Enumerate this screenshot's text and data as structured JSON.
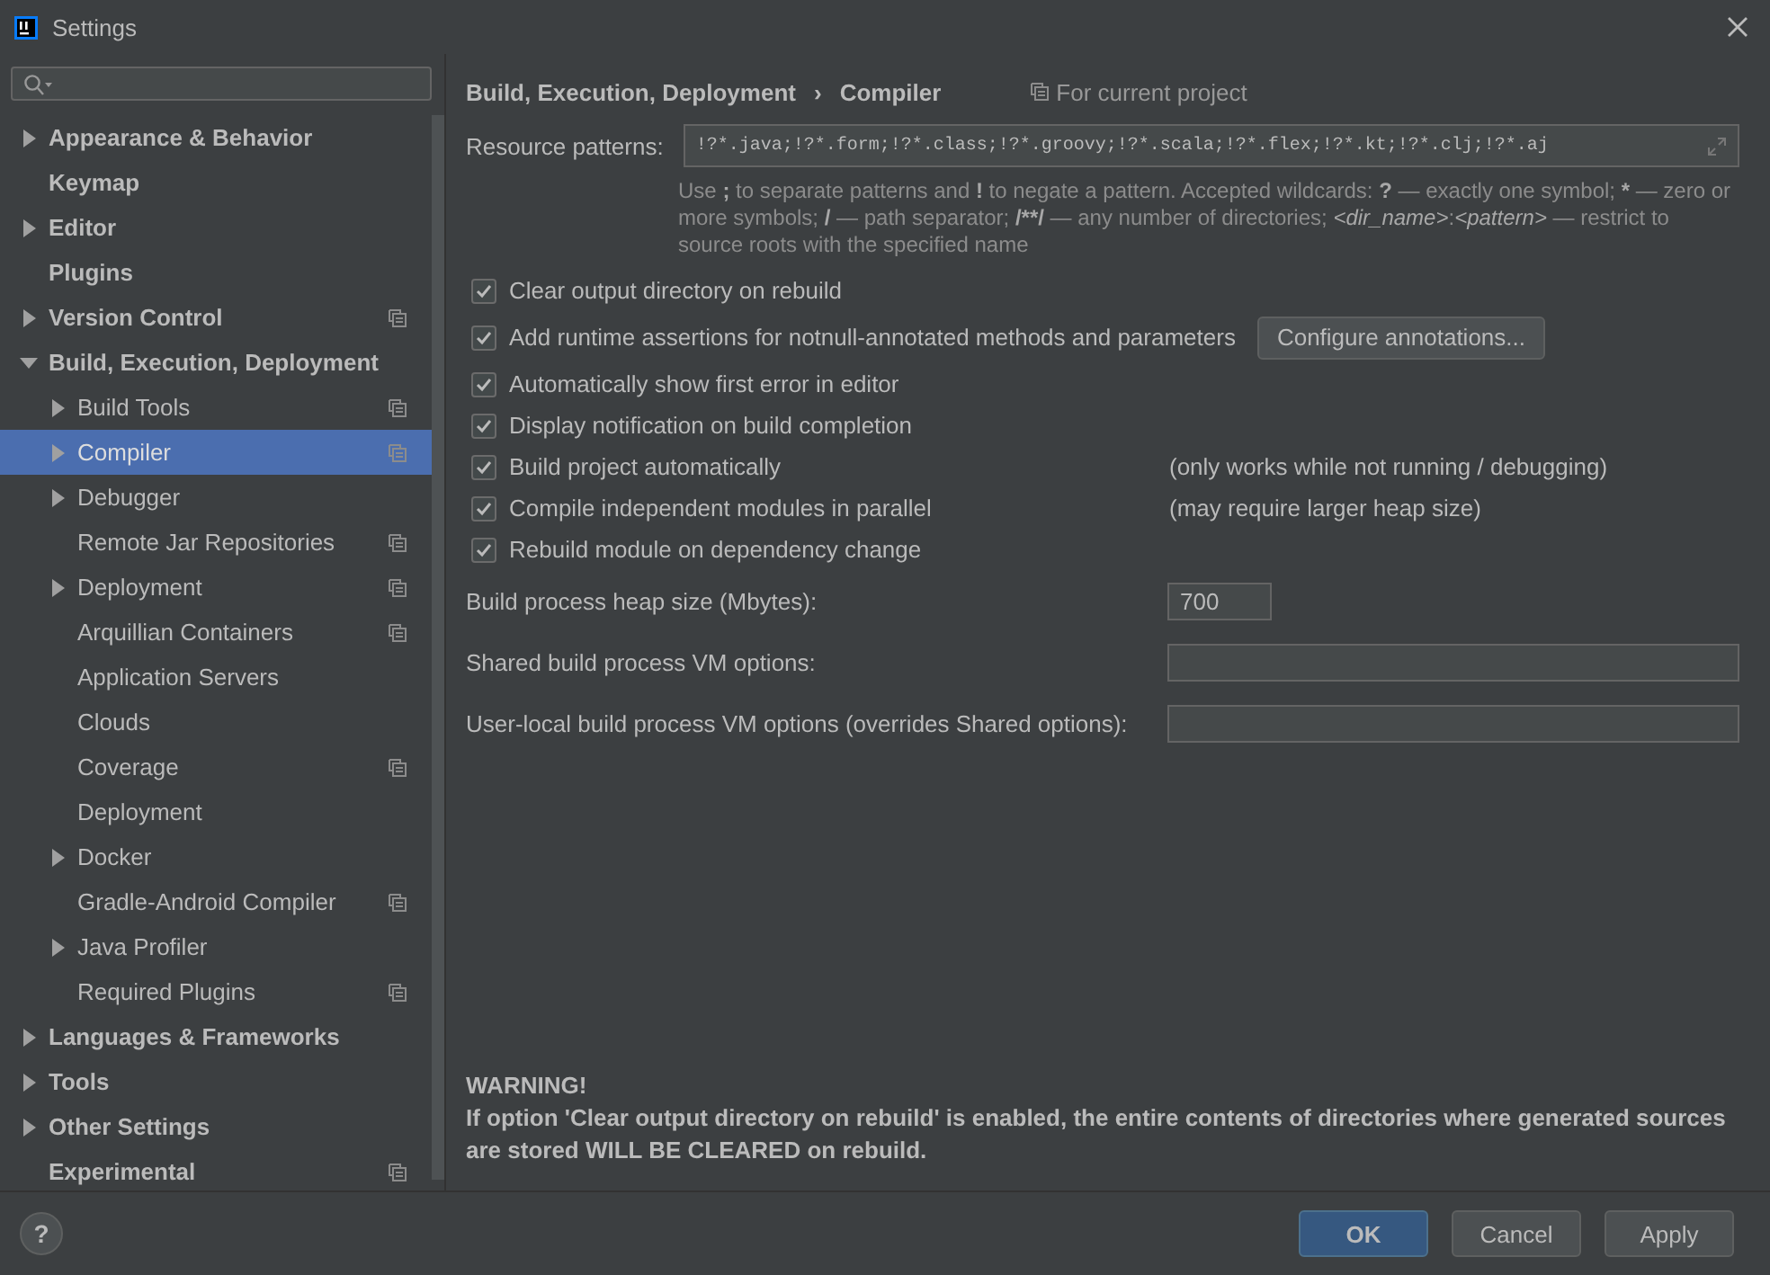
{
  "window": {
    "title": "Settings"
  },
  "tree": [
    {
      "label": "Appearance & Behavior",
      "kind": "group",
      "expanded": false,
      "selected": false,
      "project": false
    },
    {
      "label": "Keymap",
      "kind": "leaf",
      "selected": false,
      "project": false
    },
    {
      "label": "Editor",
      "kind": "group",
      "expanded": false,
      "selected": false,
      "project": false
    },
    {
      "label": "Plugins",
      "kind": "leaf",
      "selected": false,
      "project": false
    },
    {
      "label": "Version Control",
      "kind": "group",
      "expanded": false,
      "selected": false,
      "project": true
    },
    {
      "label": "Build, Execution, Deployment",
      "kind": "group",
      "expanded": true,
      "selected": false,
      "project": false,
      "children": [
        {
          "label": "Build Tools",
          "kind": "group",
          "expanded": false,
          "selected": false,
          "project": true
        },
        {
          "label": "Compiler",
          "kind": "group",
          "expanded": false,
          "selected": true,
          "project": true
        },
        {
          "label": "Debugger",
          "kind": "group",
          "expanded": false,
          "selected": false,
          "project": false
        },
        {
          "label": "Remote Jar Repositories",
          "kind": "leaf",
          "selected": false,
          "project": true
        },
        {
          "label": "Deployment",
          "kind": "group",
          "expanded": false,
          "selected": false,
          "project": true
        },
        {
          "label": "Arquillian Containers",
          "kind": "leaf",
          "selected": false,
          "project": true
        },
        {
          "label": "Application Servers",
          "kind": "leaf",
          "selected": false,
          "project": false
        },
        {
          "label": "Clouds",
          "kind": "leaf",
          "selected": false,
          "project": false
        },
        {
          "label": "Coverage",
          "kind": "leaf",
          "selected": false,
          "project": true
        },
        {
          "label": "Deployment",
          "kind": "leaf",
          "selected": false,
          "project": false
        },
        {
          "label": "Docker",
          "kind": "group",
          "expanded": false,
          "selected": false,
          "project": false
        },
        {
          "label": "Gradle-Android Compiler",
          "kind": "leaf",
          "selected": false,
          "project": true
        },
        {
          "label": "Java Profiler",
          "kind": "group",
          "expanded": false,
          "selected": false,
          "project": false
        },
        {
          "label": "Required Plugins",
          "kind": "leaf",
          "selected": false,
          "project": true
        }
      ]
    },
    {
      "label": "Languages & Frameworks",
      "kind": "group",
      "expanded": false,
      "selected": false,
      "project": false
    },
    {
      "label": "Tools",
      "kind": "group",
      "expanded": false,
      "selected": false,
      "project": false
    },
    {
      "label": "Other Settings",
      "kind": "group",
      "expanded": false,
      "selected": false,
      "project": false
    },
    {
      "label": "Experimental",
      "kind": "leaf",
      "selected": false,
      "project": true
    }
  ],
  "breadcrumb": [
    "Build, Execution, Deployment",
    "›",
    "Compiler"
  ],
  "scope": "For current project",
  "resource_patterns": {
    "label": "Resource patterns:",
    "value": "!?*.java;!?*.form;!?*.class;!?*.groovy;!?*.scala;!?*.flex;!?*.kt;!?*.clj;!?*.aj"
  },
  "help_text": [
    {
      "text": "Use ",
      "kind": "prose"
    },
    {
      "text": ";",
      "kind": "symbol"
    },
    {
      "text": " to separate patterns and ",
      "kind": "prose"
    },
    {
      "text": "!",
      "kind": "symbol"
    },
    {
      "text": " to negate a pattern. Accepted wildcards: ",
      "kind": "prose"
    },
    {
      "text": "?",
      "kind": "symbol"
    },
    {
      "text": " — exactly one symbol; ",
      "kind": "prose"
    },
    {
      "text": "*",
      "kind": "symbol"
    },
    {
      "text": " — zero or more symbols; ",
      "kind": "prose"
    },
    {
      "text": "/",
      "kind": "symbol"
    },
    {
      "text": " — path separator; ",
      "kind": "prose"
    },
    {
      "text": "/**/",
      "kind": "symbol"
    },
    {
      "text": " — any number of directories;  ",
      "kind": "prose"
    },
    {
      "text": "<dir_name>",
      "kind": "placeholder"
    },
    {
      "text": ":",
      "kind": "prose"
    },
    {
      "text": "<pattern>",
      "kind": "placeholder"
    },
    {
      "text": " — restrict to source roots with the specified name",
      "kind": "prose"
    }
  ],
  "options": [
    {
      "label": "Clear output directory on rebuild",
      "checked": true
    },
    {
      "label": "Add runtime assertions for notnull-annotated methods and parameters",
      "checked": true,
      "button": "Configure annotations..."
    },
    {
      "label": "Automatically show first error in editor",
      "checked": true
    },
    {
      "label": "Display notification on build completion",
      "checked": true
    },
    {
      "label": "Build project automatically",
      "checked": true,
      "note": "(only works while not running / debugging)"
    },
    {
      "label": "Compile independent modules in parallel",
      "checked": true,
      "note": "(may require larger heap size)"
    },
    {
      "label": "Rebuild module on dependency change",
      "checked": true
    }
  ],
  "fields": [
    {
      "label": "Build process heap size (Mbytes):",
      "value": "700",
      "kind": "short"
    },
    {
      "label": "Shared build process VM options:",
      "kind": "wide"
    },
    {
      "label": "User-local build process VM options (overrides Shared options):",
      "kind": "wide"
    }
  ],
  "warning": {
    "title": "WARNING!",
    "text": "If option 'Clear output directory on rebuild' is enabled, the entire contents of directories where generated sources are stored WILL BE CLEARED on rebuild."
  },
  "help_button": "?",
  "buttons": [
    {
      "label": "OK",
      "primary": true
    },
    {
      "label": "Cancel",
      "primary": false
    },
    {
      "label": "Apply",
      "primary": false
    }
  ]
}
